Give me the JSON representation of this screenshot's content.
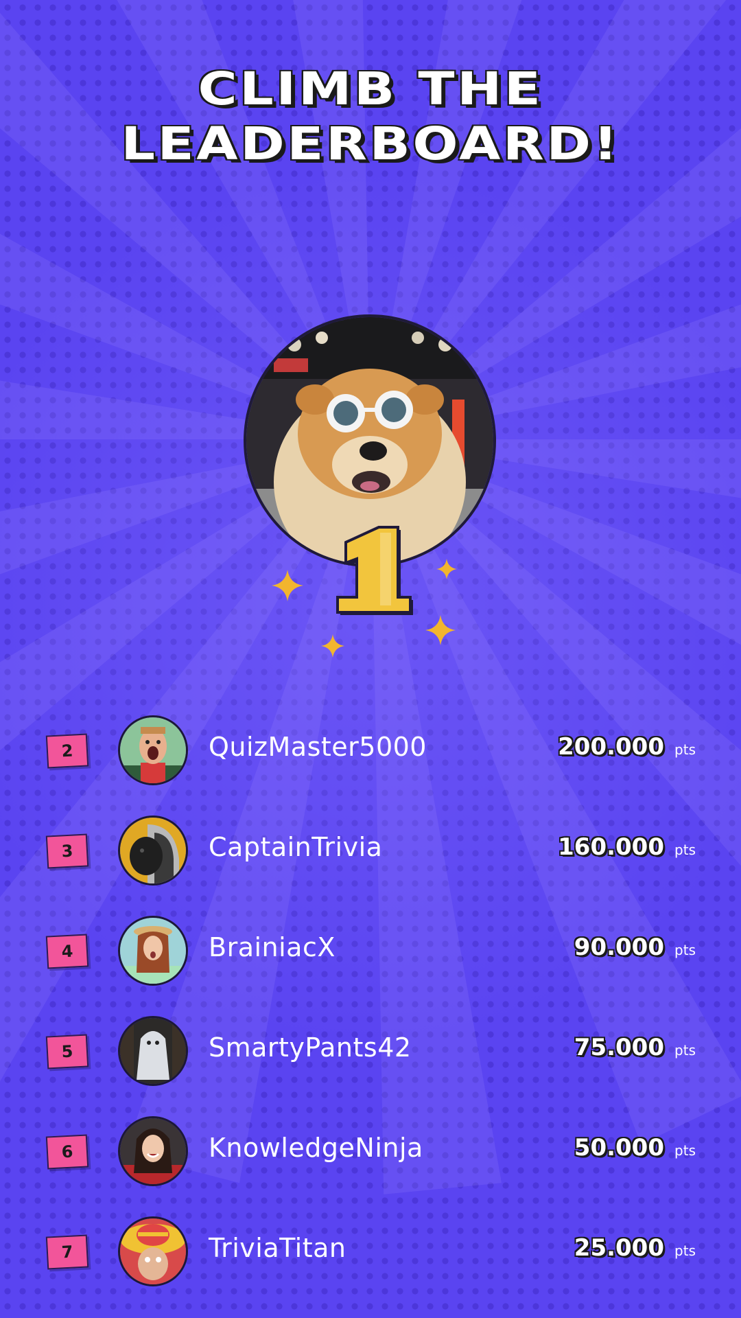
{
  "title": {
    "line1": "CLIMB THE",
    "line2": "LEADERBOARD!"
  },
  "champion": {
    "rank": "1",
    "avatar_icon": "dog-with-sunglasses-photo"
  },
  "colors": {
    "background": "#5a44f1",
    "rank_badge": "#f2559a",
    "gold": "#f2c53d",
    "text": "#ffffff"
  },
  "leaderboard": [
    {
      "rank": "2",
      "name": "QuizMaster5000",
      "score": "200.000",
      "unit": "pts",
      "avatar_icon": "surprised-man-avatar"
    },
    {
      "rank": "3",
      "name": "CaptainTrivia",
      "score": "160.000",
      "unit": "pts",
      "avatar_icon": "dog-in-hoodie-avatar"
    },
    {
      "rank": "4",
      "name": "BrainiacX",
      "score": "90.000",
      "unit": "pts",
      "avatar_icon": "woman-with-hat-avatar"
    },
    {
      "rank": "5",
      "name": "SmartyPants42",
      "score": "75.000",
      "unit": "pts",
      "avatar_icon": "ghost-costume-avatar"
    },
    {
      "rank": "6",
      "name": "KnowledgeNinja",
      "score": "50.000",
      "unit": "pts",
      "avatar_icon": "smiling-woman-avatar"
    },
    {
      "rank": "7",
      "name": "TriviaTitan",
      "score": "25.000",
      "unit": "pts",
      "avatar_icon": "sombrero-person-avatar"
    }
  ]
}
